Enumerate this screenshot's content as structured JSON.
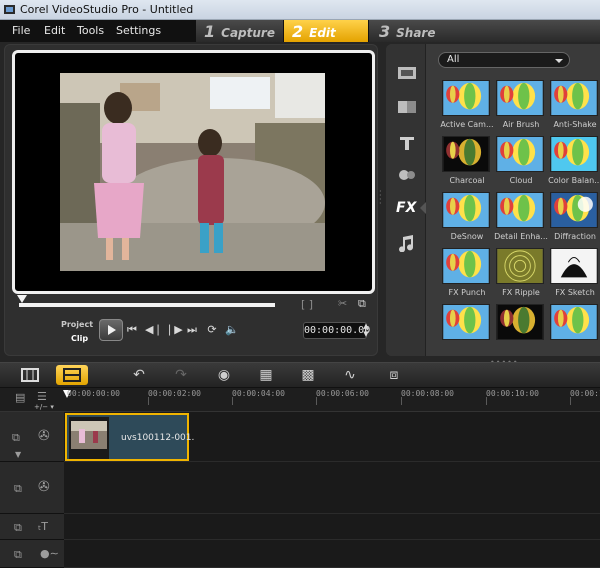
{
  "window": {
    "title": "Corel VideoStudio Pro - Untitled"
  },
  "menu": [
    "File",
    "Edit",
    "Tools",
    "Settings"
  ],
  "steps": [
    {
      "num": "1",
      "label": "Capture"
    },
    {
      "num": "2",
      "label": "Edit"
    },
    {
      "num": "3",
      "label": "Share"
    }
  ],
  "player": {
    "mode_project": "Project",
    "mode_clip": "Clip",
    "timecode": "00:00:00.00",
    "mark_brackets": "[ ]"
  },
  "library": {
    "filter": "All",
    "side_fx_label": "FX",
    "items": [
      {
        "label": "Active Cam..."
      },
      {
        "label": "Air Brush"
      },
      {
        "label": "Anti-Shake"
      },
      {
        "label": "Charcoal"
      },
      {
        "label": "Cloud"
      },
      {
        "label": "Color Balan..."
      },
      {
        "label": "DeSnow"
      },
      {
        "label": "Detail Enha..."
      },
      {
        "label": "Diffraction"
      },
      {
        "label": "FX Punch"
      },
      {
        "label": "FX Ripple"
      },
      {
        "label": "FX Sketch"
      },
      {
        "label": ""
      },
      {
        "label": ""
      },
      {
        "label": ""
      }
    ]
  },
  "ruler": {
    "ticks": [
      "00:00:00:00",
      "00:00:02:00",
      "00:00:04:00",
      "00:00:06:00",
      "00:00:08:00",
      "00:00:10:00",
      "00:00:12"
    ],
    "zoom": "+/− ▾"
  },
  "timeline": {
    "clip_label": "uvs100112-001."
  }
}
